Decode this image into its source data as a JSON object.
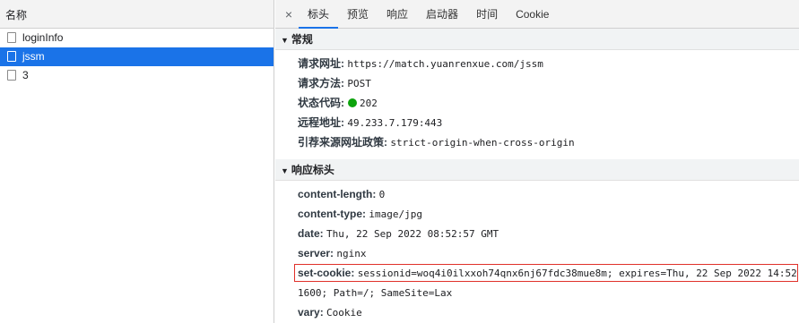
{
  "left": {
    "header": "名称",
    "requests": [
      "loginInfo",
      "jssm",
      "3"
    ],
    "selected_index": 1
  },
  "tabs": {
    "close": "×",
    "items": [
      "标头",
      "预览",
      "响应",
      "启动器",
      "时间",
      "Cookie"
    ],
    "active": 0
  },
  "general": {
    "title": "常规",
    "url_label": "请求网址:",
    "url": "https://match.yuanrenxue.com/jssm",
    "method_label": "请求方法:",
    "method": "POST",
    "status_label": "状态代码:",
    "status": "202",
    "status_color": "#0ca30c",
    "remote_label": "远程地址:",
    "remote": "49.233.7.179:443",
    "referrer_label": "引荐来源网址政策:",
    "referrer": "strict-origin-when-cross-origin"
  },
  "response": {
    "title": "响应标头",
    "content_length_label": "content-length:",
    "content_length": "0",
    "content_type_label": "content-type:",
    "content_type": "image/jpg",
    "date_label": "date:",
    "date": "Thu, 22 Sep 2022 08:52:57 GMT",
    "server_label": "server:",
    "server": "nginx",
    "set_cookie_label": "set-cookie:",
    "set_cookie": "sessionid=woq4i0ilxxoh74qnx6nj67fdc38mue8m; expires=Thu, 22 Sep 2022 14:52:",
    "set_cookie_cont": "1600; Path=/; SameSite=Lax",
    "vary_label": "vary:",
    "vary": "Cookie"
  },
  "colors": {
    "accent": "#1a73e8",
    "highlight_box": "#e0312a"
  }
}
